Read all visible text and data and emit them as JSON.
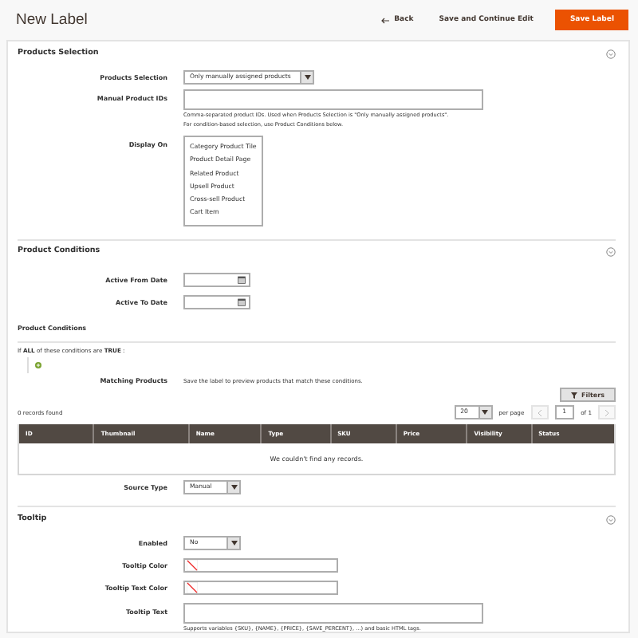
{
  "header": {
    "title": "New Label",
    "back": "Back",
    "save_continue": "Save and Continue Edit",
    "save": "Save Label"
  },
  "sections": [
    {
      "title": "Products Selection",
      "fields": [
        {
          "kind": "select",
          "label": "Products Selection",
          "value": "Only manually assigned products"
        },
        {
          "kind": "textarea",
          "label": "Manual Product IDs",
          "note": [
            "Comma-separated product IDs. Used when Products Selection is \"Only manually assigned products\".",
            "For condition-based selection, use Product Conditions below."
          ]
        },
        {
          "kind": "listbox",
          "label": "Display On",
          "options": [
            {
              "label": "Category Product Tile",
              "selected": false
            },
            {
              "label": "Product Detail Page",
              "selected": false
            },
            {
              "label": "Related Product",
              "selected": false
            },
            {
              "label": "Upsell Product",
              "selected": false
            },
            {
              "label": "Cross-sell Product",
              "selected": false
            },
            {
              "label": "Cart Item",
              "selected": false
            }
          ]
        }
      ]
    },
    {
      "title": "Product Conditions",
      "fields": [
        {
          "kind": "date",
          "label": "Active From Date"
        },
        {
          "kind": "date",
          "label": "Active To Date"
        },
        {
          "kind": "subheading",
          "label": "Product Conditions"
        },
        {
          "kind": "conditions",
          "text": "If **ALL** of these conditions are **TRUE** :"
        },
        {
          "kind": "info",
          "label": "Matching Products",
          "value": "Save the label to preview products that match these conditions."
        },
        {
          "kind": "grid",
          "filters": "Filters",
          "records": "0 records found",
          "page_size": "20",
          "per_page": "per page",
          "page": "1",
          "of": "of 1",
          "columns": [
            "ID",
            "Thumbnail",
            "Name",
            "Type",
            "SKU",
            "Price",
            "Visibility",
            "Status"
          ],
          "empty": "We couldn't find any records."
        },
        {
          "kind": "select",
          "label": "Source Type",
          "value": "Manual"
        }
      ]
    },
    {
      "title": "Tooltip",
      "fields": [
        {
          "kind": "select",
          "label": "Enabled",
          "value": "No"
        },
        {
          "kind": "color",
          "label": "Tooltip Color"
        },
        {
          "kind": "color",
          "label": "Tooltip Text Color"
        },
        {
          "kind": "textarea",
          "label": "Tooltip Text",
          "note": [
            "Supports variables {SKU}, {NAME}, {PRICE}, {SAVE_PERCENT}, ...) and basic HTML tags."
          ]
        }
      ]
    }
  ]
}
